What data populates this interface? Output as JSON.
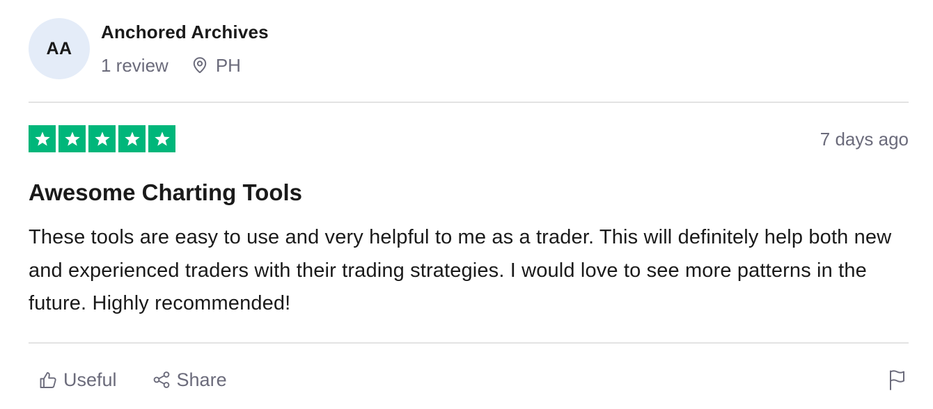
{
  "reviewer": {
    "initials": "AA",
    "name": "Anchored Archives",
    "review_count": "1 review",
    "location": "PH",
    "icons": {
      "location": "location-pin-icon"
    }
  },
  "review": {
    "rating": 5,
    "max_rating": 5,
    "star_color": "#00b67a",
    "date": "7 days ago",
    "title": "Awesome Charting Tools",
    "text": "These tools are easy to use and very helpful to me as a trader. This will definitely help both new and experienced traders with their trading strategies. I would love to see more patterns in the future. Highly recommended!"
  },
  "actions": {
    "useful_label": "Useful",
    "share_label": "Share",
    "icons": {
      "useful": "thumbs-up-icon",
      "share": "share-icon",
      "report": "flag-icon"
    }
  },
  "colors": {
    "muted_text": "#6b6b7b",
    "avatar_bg": "#e4ecf8",
    "divider": "#e3e3e3"
  }
}
